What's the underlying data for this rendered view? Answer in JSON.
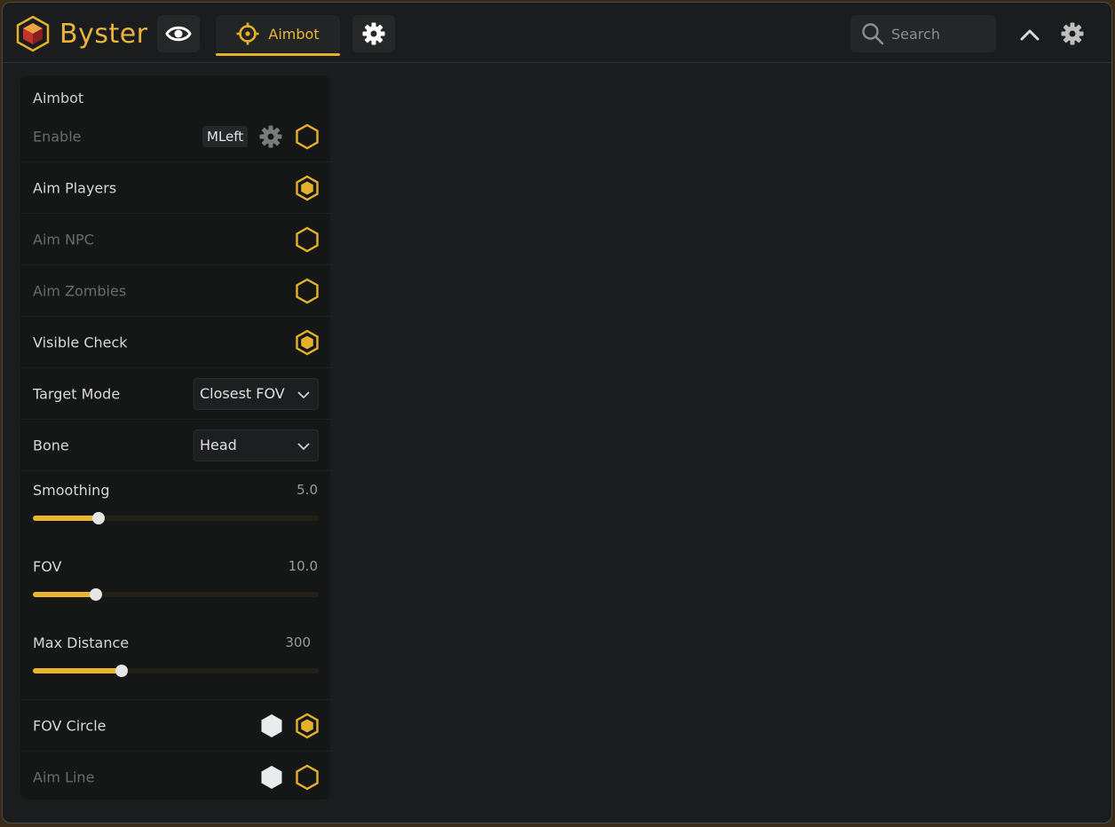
{
  "app": {
    "brand": "Byster",
    "accent_color": "#e5b12d",
    "tabs": [
      {
        "icon": "eye-icon"
      },
      {
        "icon": "crosshair-icon",
        "label": "Aimbot",
        "active": true
      },
      {
        "icon": "gear-icon"
      }
    ],
    "search_placeholder": "Search"
  },
  "panel": {
    "title": "Aimbot",
    "enable": {
      "label": "Enable",
      "keybind": "MLeft",
      "checked": false
    },
    "toggles": [
      {
        "label": "Aim Players",
        "checked": true
      },
      {
        "label": "Aim NPC",
        "checked": false
      },
      {
        "label": "Aim Zombies",
        "checked": false
      },
      {
        "label": "Visible Check",
        "checked": true
      }
    ],
    "target_mode": {
      "label": "Target Mode",
      "value": "Closest FOV"
    },
    "bone": {
      "label": "Bone",
      "value": "Head"
    },
    "smoothing": {
      "label": "Smoothing",
      "value": "5.0",
      "fraction": 0.23
    },
    "fov": {
      "label": "FOV",
      "value": "10.0",
      "fraction": 0.22
    },
    "max_distance": {
      "label": "Max Distance",
      "value": "300",
      "fraction": 0.31
    },
    "fov_circle": {
      "label": "FOV Circle",
      "color": "#e8ecee",
      "checked": true
    },
    "aim_line": {
      "label": "Aim Line",
      "color": "#e8ecee",
      "checked": false
    }
  }
}
